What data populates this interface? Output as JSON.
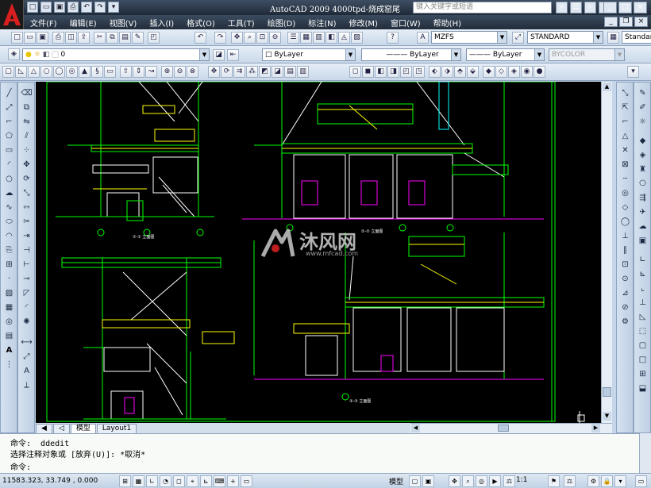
{
  "app": {
    "title": "AutoCAD 2009  4000tpd-烧成窑尾",
    "help_search_placeholder": "键入关键字或短语"
  },
  "menu": [
    "文件(F)",
    "编辑(E)",
    "视图(V)",
    "插入(I)",
    "格式(O)",
    "工具(T)",
    "绘图(D)",
    "标注(N)",
    "修改(M)",
    "窗口(W)",
    "帮助(H)"
  ],
  "styles": {
    "text_style": "MZFS",
    "dim_style": "STANDARD",
    "table_style": "Standar"
  },
  "layers": {
    "current_layer": "0",
    "color": "ByLayer",
    "linetype": "ByLayer",
    "lineweight": "ByLayer",
    "plot_style": "BYCOLOR"
  },
  "tabs": [
    "模型",
    "Layout1"
  ],
  "command": {
    "line1": "命令:  ddedit",
    "line2": "选择注释对象或 [放弃(U)]: *取消*",
    "line3": "命令:"
  },
  "status": {
    "coordinates": "11583.323, 33.749 , 0.000",
    "model": "模型",
    "annotation_scale": "1:1"
  },
  "drawing_labels": {
    "view1": "①-① 立面图",
    "view2": "②-② 立面图",
    "view3": "③-③ 立面图"
  },
  "watermark": {
    "brand": "沐风网",
    "url": "www.mfcad.com"
  },
  "colors": {
    "canvas": "#000000",
    "accent_green": "#00ff00",
    "title_bar": "#2b3848"
  }
}
